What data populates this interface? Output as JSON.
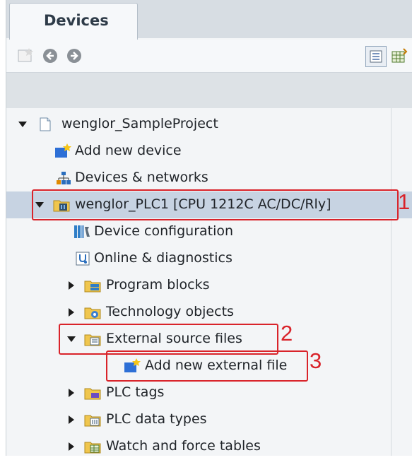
{
  "tab": {
    "label": "Devices"
  },
  "tree": {
    "project": "wenglor_SampleProject",
    "add_device": "Add new device",
    "devices_networks": "Devices & networks",
    "plc": "wenglor_PLC1 [CPU 1212C AC/DC/Rly]",
    "device_config": "Device configuration",
    "online_diag": "Online & diagnostics",
    "program_blocks": "Program blocks",
    "tech_objects": "Technology objects",
    "external_source": "External source files",
    "add_external": "Add new external file",
    "plc_tags": "PLC tags",
    "plc_data_types": "PLC data types",
    "watch_force": "Watch and force tables"
  },
  "annotations": {
    "n1": "1",
    "n2": "2",
    "n3": "3"
  },
  "colors": {
    "annotation": "#d9232a",
    "selection": "#c7d3e2"
  }
}
